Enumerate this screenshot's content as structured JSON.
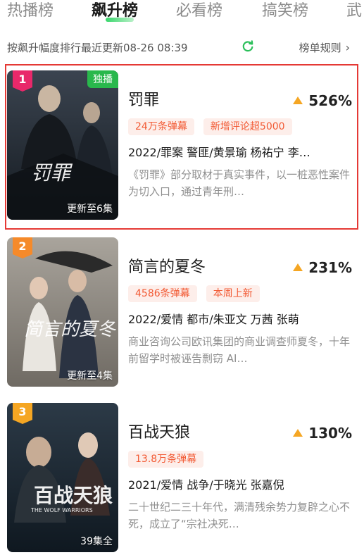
{
  "tabs": [
    "热播榜",
    "飙升榜",
    "必看榜",
    "搞笑榜",
    "武"
  ],
  "subbar": {
    "updated_text": "按飙升幅度排行最近更新08-26 08:39",
    "rules_label": "榜单规则"
  },
  "colors": {
    "accent_green": "#29b84c",
    "rise_orange": "#f5a623",
    "badge_text": "#f25a34"
  },
  "items": [
    {
      "rank": "1",
      "title": "罚罪",
      "rise": "526%",
      "exclusive": "独播",
      "episodes": "更新至6集",
      "poster_text": "罚罪",
      "badges": [
        "24万条弹幕",
        "新增评论超5000"
      ],
      "meta": "2022/罪案 警匪/黄景瑜 杨祐宁 李…",
      "desc": "《罚罪》部分取材于真实事件，以一桩恶性案件为切入口，通过青年刑…"
    },
    {
      "rank": "2",
      "title": "简言的夏冬",
      "rise": "231%",
      "exclusive": "",
      "episodes": "更新至4集",
      "poster_text": "简言的夏冬",
      "badges": [
        "4586条弹幕",
        "本周上新"
      ],
      "meta": "2022/爱情 都市/朱亚文 万茜 张萌",
      "desc": "商业咨询公司欧讯集团的商业调查师夏冬，十年前留学时被诬告剽窃 AI…"
    },
    {
      "rank": "3",
      "title": "百战天狼",
      "rise": "130%",
      "exclusive": "",
      "episodes": "39集全",
      "poster_text": "百战天狼",
      "poster_subtext": "THE WOLF WARRIORS",
      "badges": [
        "13.8万条弹幕"
      ],
      "meta": "2021/爱情 战争/于晓光 张嘉倪",
      "desc": "二十世纪二三十年代，满清残余势力复辟之心不死，成立了“宗社决死…"
    }
  ]
}
